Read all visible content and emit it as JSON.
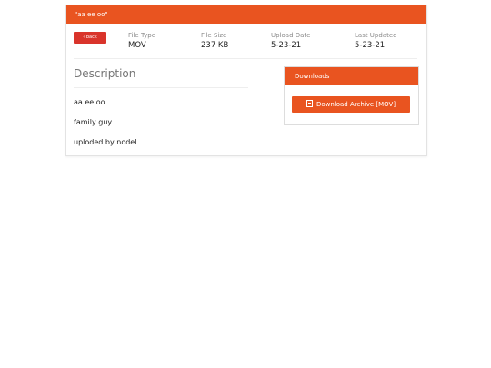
{
  "header": {
    "title": "\"aa ee oo\""
  },
  "back_button": {
    "label": "‹ back"
  },
  "meta": [
    {
      "label": "File Type",
      "value": "MOV"
    },
    {
      "label": "File Size",
      "value": "237 KB"
    },
    {
      "label": "Upload Date",
      "value": "5-23-21"
    },
    {
      "label": "Last Updated",
      "value": "5-23-21"
    }
  ],
  "description": {
    "title": "Description",
    "lines": [
      "aa ee oo",
      "family guy",
      "uploded by nodel"
    ]
  },
  "downloads": {
    "title": "Downloads",
    "button_label": "Download Archive [MOV]",
    "button_icon": "file-icon"
  },
  "colors": {
    "accent": "#e95420",
    "back": "#d9342b"
  }
}
